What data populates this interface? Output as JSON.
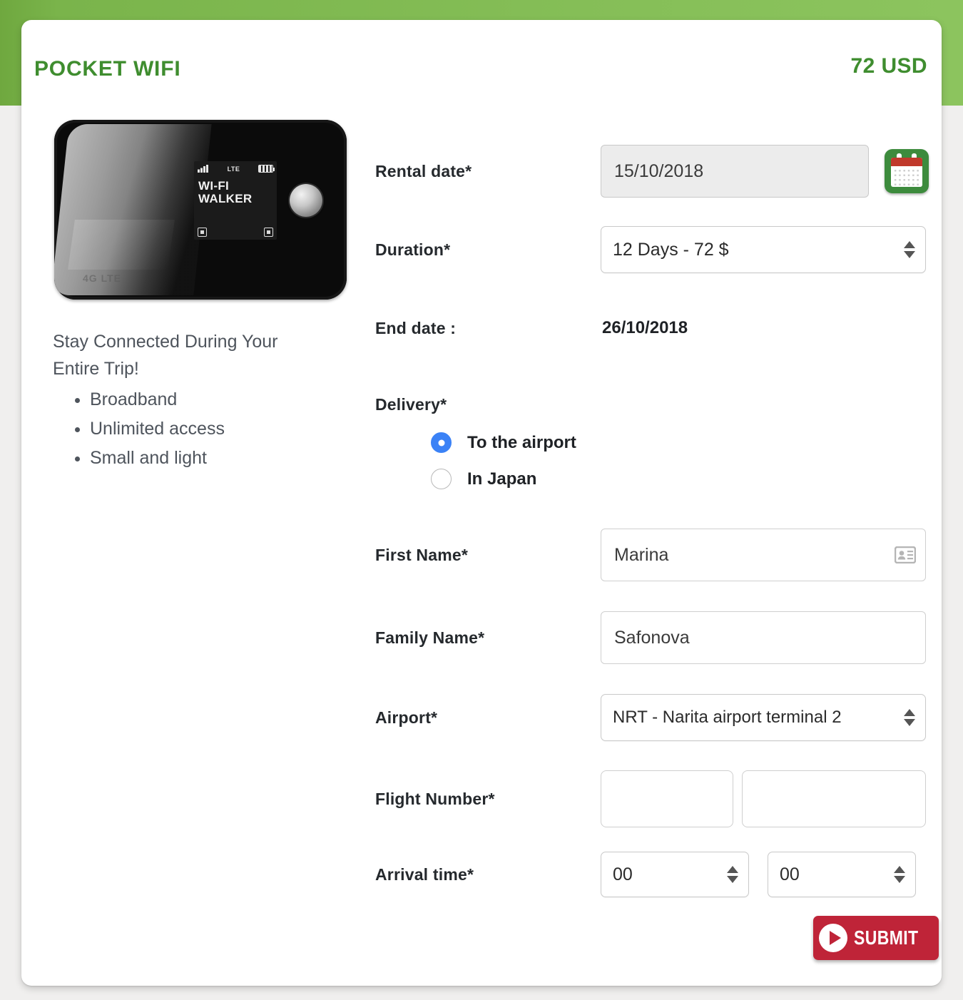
{
  "header": {
    "title": "POCKET WIFI",
    "price": "72 USD"
  },
  "product": {
    "device_alt": "pocket-wifi-router",
    "device_screen": {
      "brand_line1": "WI-FI",
      "brand_line2": "WALKER",
      "network_label": "LTE",
      "bottom_label": "4G LTE"
    },
    "headline": "Stay Connected During Your Entire Trip!",
    "features": [
      "Broadband",
      "Unlimited access",
      "Small and light"
    ]
  },
  "form": {
    "rental_date": {
      "label": "Rental date*",
      "value": "15/10/2018",
      "calendar_icon": "calendar-icon"
    },
    "duration": {
      "label": "Duration*",
      "value": "12 Days - 72 $"
    },
    "end_date": {
      "label": "End date :",
      "value": "26/10/2018"
    },
    "delivery": {
      "label": "Delivery*",
      "options": [
        {
          "label": "To the airport",
          "selected": true
        },
        {
          "label": "In Japan",
          "selected": false
        }
      ]
    },
    "first_name": {
      "label": "First Name*",
      "value": "Marina",
      "icon": "contact-card-icon"
    },
    "family_name": {
      "label": "Family Name*",
      "value": "Safonova"
    },
    "airport": {
      "label": "Airport*",
      "value": "NRT - Narita airport terminal 2"
    },
    "flight_number": {
      "label": "Flight Number*",
      "value_prefix": "",
      "value_suffix": ""
    },
    "arrival_time": {
      "label": "Arrival time*",
      "hours": "00",
      "minutes": "00"
    },
    "submit": {
      "label": "SUBMIT",
      "icon": "play-circle-icon"
    }
  },
  "colors": {
    "brand_green": "#3f8d2f",
    "band_green": "#7ab34a",
    "submit_red": "#bf2438",
    "radio_blue": "#3b82f6",
    "calendar_band_red": "#c0392b"
  }
}
